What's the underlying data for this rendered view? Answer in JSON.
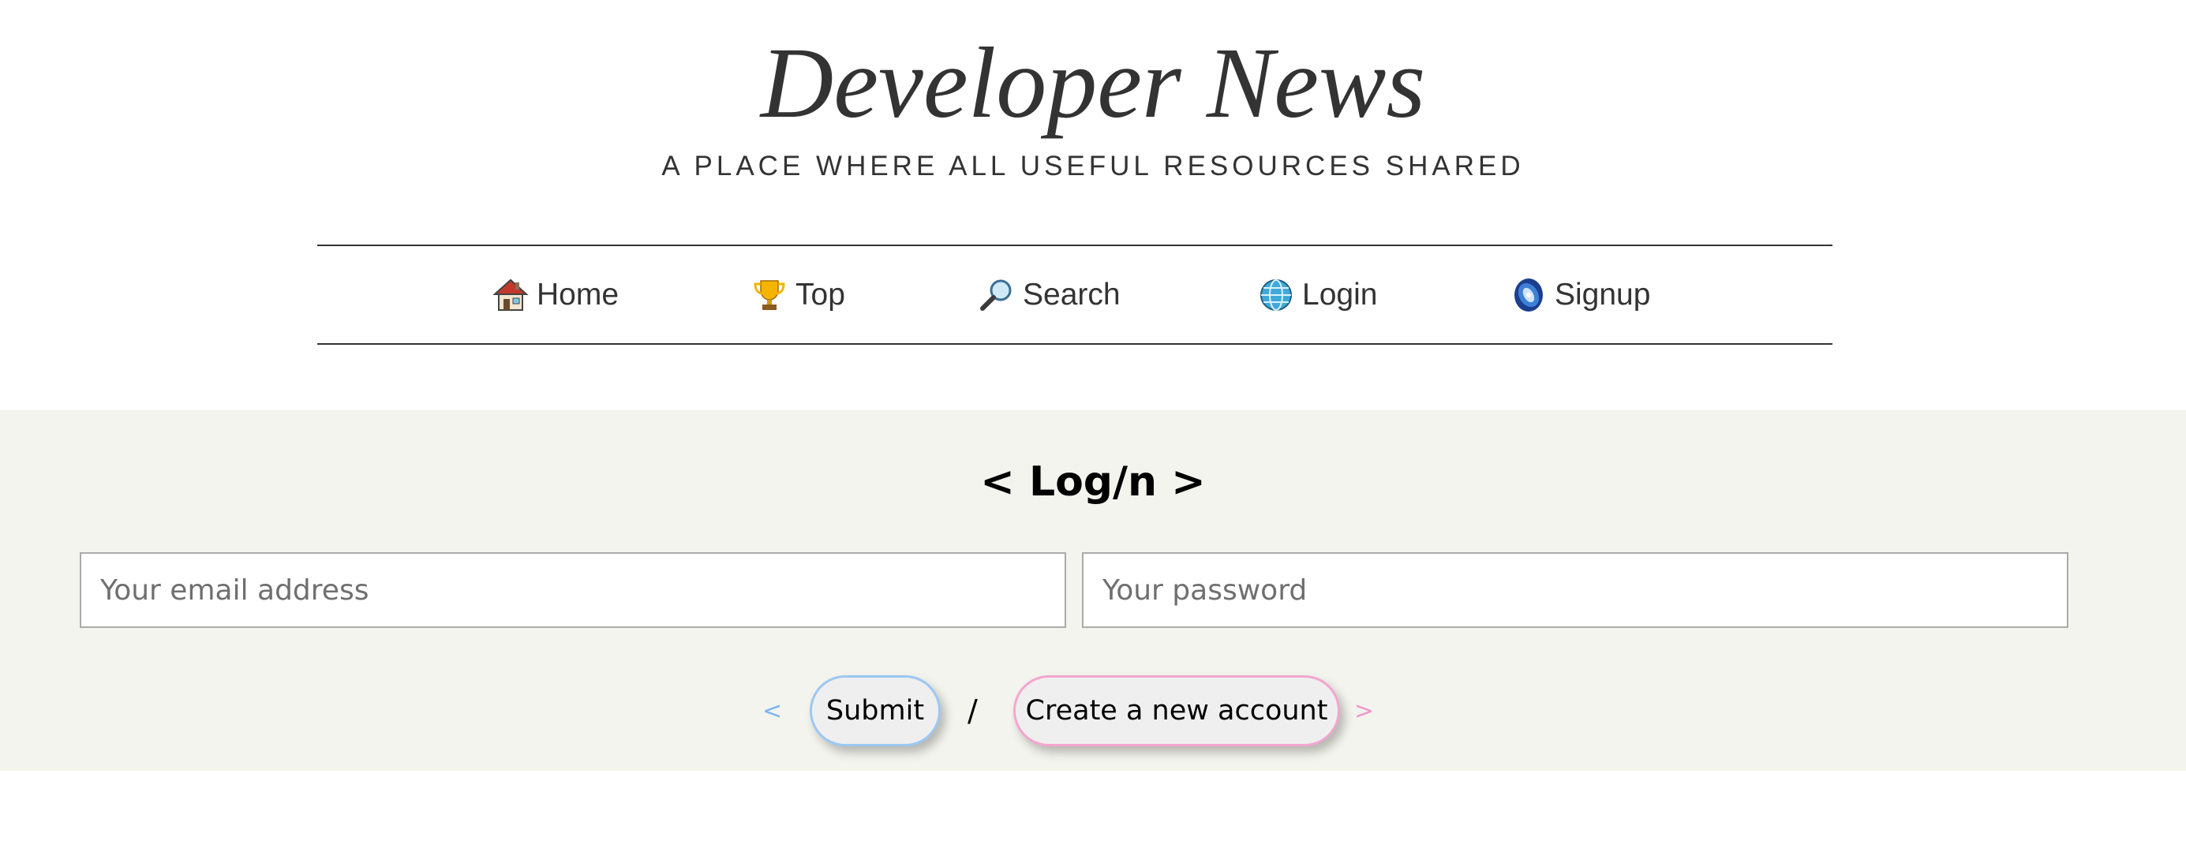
{
  "header": {
    "title": "Developer News",
    "tagline": "A PLACE WHERE ALL USEFUL RESOURCES SHARED"
  },
  "nav": {
    "items": [
      {
        "label": "Home",
        "icon": "house-icon"
      },
      {
        "label": "Top",
        "icon": "trophy-icon"
      },
      {
        "label": "Search",
        "icon": "magnifier-icon"
      },
      {
        "label": "Login",
        "icon": "globe-icon"
      },
      {
        "label": "Signup",
        "icon": "galaxy-icon"
      }
    ]
  },
  "login": {
    "title": "< Log/n >",
    "email_placeholder": "Your email address",
    "password_placeholder": "Your password",
    "bracket_left": "<",
    "bracket_right": ">",
    "submit_label": "Submit",
    "separator": "/",
    "create_label": "Create a new account"
  },
  "colors": {
    "login_background": "#f4f4ee",
    "submit_border": "#9cc8f2",
    "create_border": "#f4a6cf"
  }
}
